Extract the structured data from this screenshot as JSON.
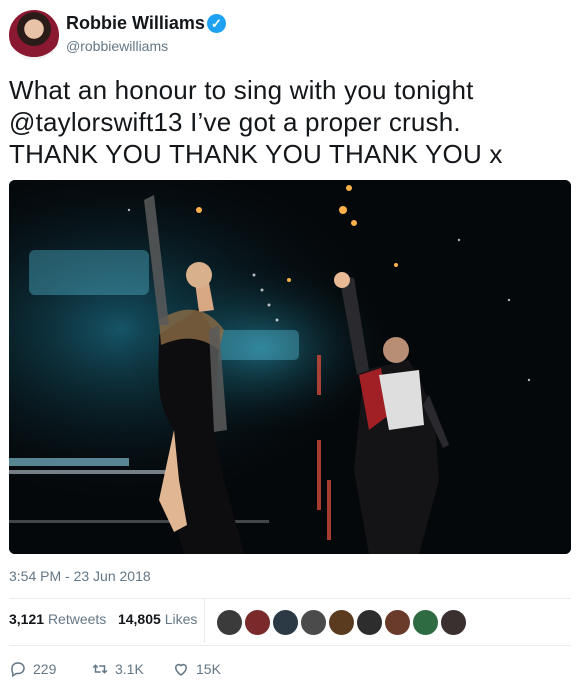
{
  "profile": {
    "name": "Robbie Williams",
    "handle": "@robbiewilliams",
    "verified_icon": "verified-check-icon"
  },
  "tweet": {
    "line1": "What an honour to sing with you tonight",
    "line2": "@taylorswift13  I’ve got a proper crush.",
    "line3": "THANK YOU THANK YOU THANK YOU x"
  },
  "timestamp": "3:54 PM - 23 Jun 2018",
  "stats": {
    "retweets_count": "3,121",
    "retweets_label": "Retweets",
    "likes_count": "14,805",
    "likes_label": "Likes"
  },
  "actions": {
    "reply_count": "229",
    "retweet_count": "3.1K",
    "like_count": "15K"
  },
  "colors": {
    "link": "#1da1f2",
    "muted": "#657786"
  }
}
